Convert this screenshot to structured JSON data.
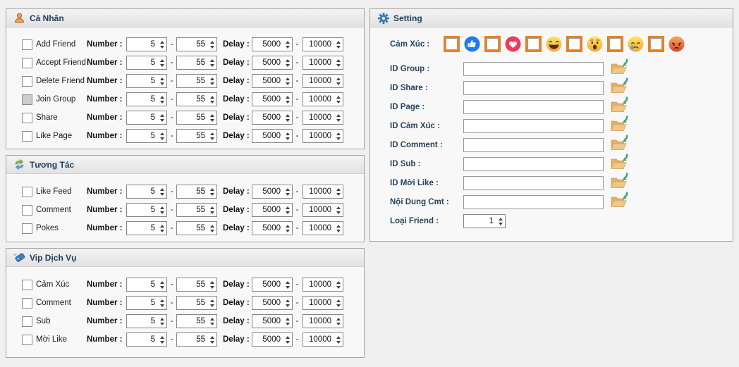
{
  "colors": {
    "accent_orange": "#e8821e",
    "like_blue": "#1d7af2",
    "love_red": "#ee3b5c",
    "emoji_yellow": "#fed75a",
    "angry_red": "#d5472e",
    "folder_tan": "#eac185",
    "folder_arrow_green": "#4aa37d",
    "title_navy": "#1e3d5c",
    "group_border": "#a5a5a5",
    "page_bg": "#f0f0f0"
  },
  "defaults": {
    "number_label": "Number :",
    "delay_label": "Delay :",
    "dash": "-",
    "number_min": "5",
    "number_max": "55",
    "delay_min": "5000",
    "delay_max": "10000"
  },
  "groups": [
    {
      "title": "Cá Nhân",
      "icon": "person-icon",
      "rows": [
        {
          "label": "Add Friend",
          "state": "unchecked"
        },
        {
          "label": "Accept Friend",
          "state": "unchecked"
        },
        {
          "label": "Delete Friend",
          "state": "unchecked"
        },
        {
          "label": "Join Group",
          "state": "indeterminate"
        },
        {
          "label": "Share",
          "state": "unchecked"
        },
        {
          "label": "Like Page",
          "state": "unchecked"
        }
      ]
    },
    {
      "title": "Tương Tác",
      "icon": "sync-icon",
      "rows": [
        {
          "label": "Like Feed",
          "state": "unchecked"
        },
        {
          "label": "Comment",
          "state": "unchecked"
        },
        {
          "label": "Pokes",
          "state": "unchecked"
        }
      ]
    },
    {
      "title": "Vip Dịch Vụ",
      "icon": "tag-icon",
      "rows": [
        {
          "label": "Cảm Xúc",
          "state": "unchecked"
        },
        {
          "label": "Comment",
          "state": "unchecked"
        },
        {
          "label": "Sub",
          "state": "unchecked"
        },
        {
          "label": "Mời Like",
          "state": "unchecked"
        }
      ]
    }
  ],
  "setting": {
    "title": "Setting",
    "icon": "gear-icon",
    "reactions_label": "Cảm Xúc :",
    "reactions": [
      "like-emoji",
      "love-emoji",
      "haha-emoji",
      "wow-emoji",
      "sad-emoji",
      "angry-emoji"
    ],
    "fields": [
      {
        "label": "ID Group :",
        "value": ""
      },
      {
        "label": "ID Share :",
        "value": ""
      },
      {
        "label": "ID Page :",
        "value": ""
      },
      {
        "label": "ID Cảm Xúc :",
        "value": ""
      },
      {
        "label": "ID Comment :",
        "value": ""
      },
      {
        "label": "ID Sub :",
        "value": ""
      },
      {
        "label": "ID Mời Like :",
        "value": ""
      },
      {
        "label": "Nội Dung Cmt :",
        "value": ""
      }
    ],
    "loai_friend": {
      "label": "Loại Friend :",
      "value": "1"
    }
  }
}
